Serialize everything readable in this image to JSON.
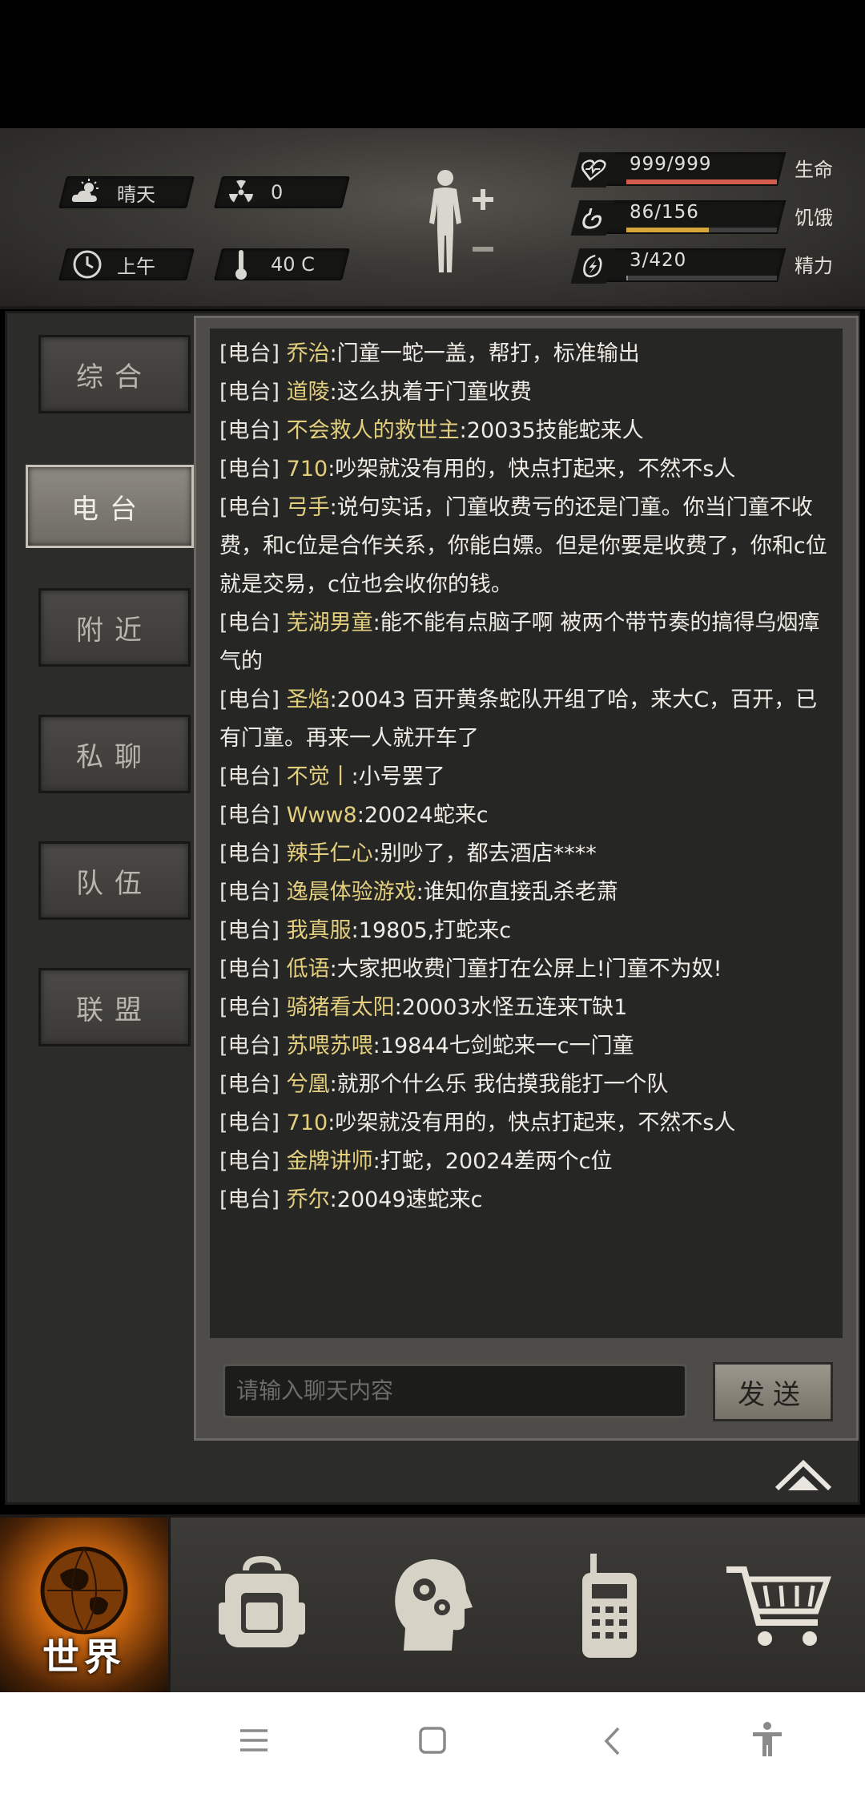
{
  "status": {
    "weather": "晴天",
    "radiation": "0",
    "time_of_day": "上午",
    "temperature": "40 C",
    "stats": [
      {
        "name": "生命",
        "value": "999/999",
        "fraction": 1.0,
        "color": "#d45c4e",
        "icon": "heart-icon"
      },
      {
        "name": "饥饿",
        "value": "86/156",
        "fraction": 0.55,
        "color": "#d8a63a",
        "icon": "stomach-icon"
      },
      {
        "name": "精力",
        "value": "3/420",
        "fraction": 0.01,
        "color": "#8a8a8a",
        "icon": "energy-icon"
      }
    ]
  },
  "tabs": [
    {
      "label": "综合",
      "active": false
    },
    {
      "label": "电台",
      "active": true
    },
    {
      "label": "附近",
      "active": false
    },
    {
      "label": "私聊",
      "active": false
    },
    {
      "label": "队伍",
      "active": false
    },
    {
      "label": "联盟",
      "active": false
    }
  ],
  "chat": {
    "messages": [
      {
        "channel": "[电台]",
        "name": "乔治",
        "text": ":门童一蛇一盖，帮打，标准输出"
      },
      {
        "channel": "[电台]",
        "name": "道陵",
        "text": ":这么执着于门童收费"
      },
      {
        "channel": "[电台]",
        "name": "不会救人的救世主",
        "text": ":20035技能蛇来人"
      },
      {
        "channel": "[电台]",
        "name": "710",
        "text": ":吵架就没有用的，快点打起来，不然不s人"
      },
      {
        "channel": "[电台]",
        "name": "弓手",
        "text": ":说句实话，门童收费亏的还是门童。你当门童不收费，和c位是合作关系，你能白嫖。但是你要是收费了，你和c位就是交易，c位也会收你的钱。"
      },
      {
        "channel": "[电台]",
        "name": "芜湖男童",
        "text": ":能不能有点脑子啊 被两个带节奏的搞得乌烟瘴气的"
      },
      {
        "channel": "[电台]",
        "name": "圣焰",
        "text": ":20043 百开黄条蛇队开组了哈，来大C，百开，已有门童。再来一人就开车了"
      },
      {
        "channel": "[电台]",
        "name": "不觉丨",
        "text": ":小号罢了"
      },
      {
        "channel": "[电台]",
        "name": "Www8",
        "text": ":20024蛇来c"
      },
      {
        "channel": "[电台]",
        "name": "辣手仁心",
        "text": ":别吵了，都去酒店****"
      },
      {
        "channel": "[电台]",
        "name": "逸晨体验游戏",
        "text": ":谁知你直接乱杀老萧"
      },
      {
        "channel": "[电台]",
        "name": "我真服",
        "text": ":19805,打蛇来c"
      },
      {
        "channel": "[电台]",
        "name": "低语",
        "text": ":大家把收费门童打在公屏上!门童不为奴!"
      },
      {
        "channel": "[电台]",
        "name": "骑猪看太阳",
        "text": ":20003水怪五连来T缺1"
      },
      {
        "channel": "[电台]",
        "name": "苏喂苏喂",
        "text": ":19844七剑蛇来一c一门童"
      },
      {
        "channel": "[电台]",
        "name": "兮凰",
        "text": ":就那个什么乐 我估摸我能打一个队"
      },
      {
        "channel": "[电台]",
        "name": "710",
        "text": ":吵架就没有用的，快点打起来，不然不s人"
      },
      {
        "channel": "[电台]",
        "name": "金牌讲师",
        "text": ":打蛇，20024差两个c位"
      },
      {
        "channel": "[电台]",
        "name": "乔尔",
        "text": ":20049速蛇来c"
      }
    ],
    "input_placeholder": "请输入聊天内容",
    "send_label": "发送"
  },
  "nav": {
    "world_label": "世界",
    "items": [
      "globe-icon",
      "backpack-icon",
      "head-gears-icon",
      "radio-icon",
      "cart-icon"
    ]
  }
}
